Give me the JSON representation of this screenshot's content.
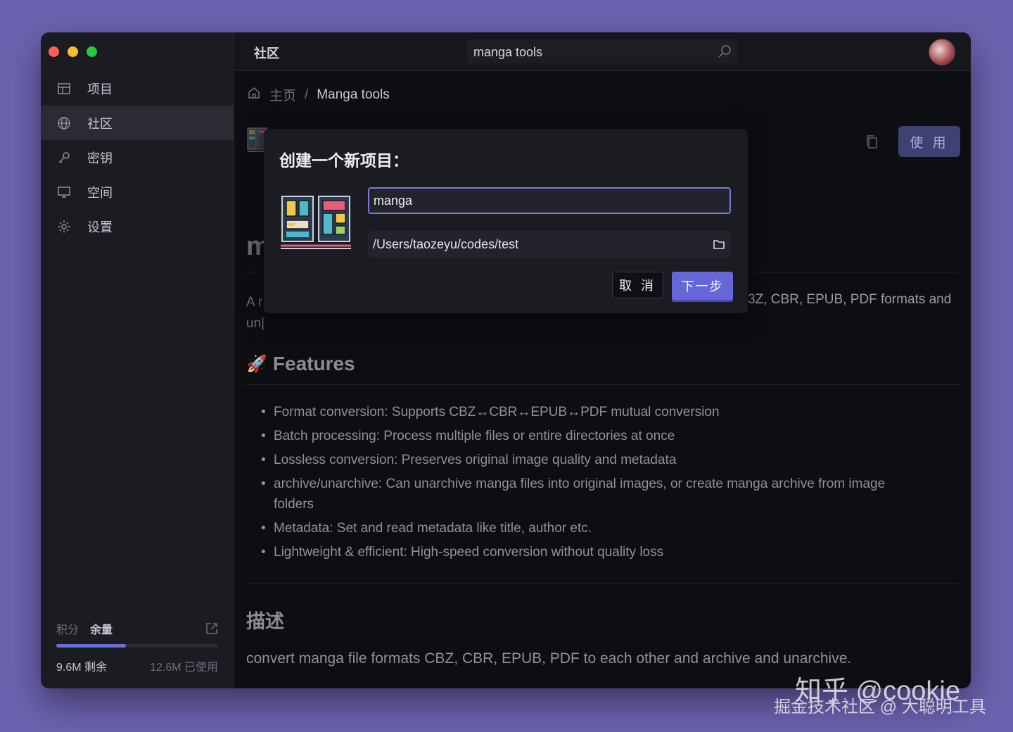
{
  "sidebar": {
    "items": [
      {
        "label": "项目",
        "icon": "grid-icon"
      },
      {
        "label": "社区",
        "icon": "globe-icon"
      },
      {
        "label": "密钥",
        "icon": "key-icon"
      },
      {
        "label": "空间",
        "icon": "monitor-icon"
      },
      {
        "label": "设置",
        "icon": "gear-icon"
      }
    ],
    "active": "社区",
    "footer": {
      "tab_points": "积分",
      "tab_balance": "余量",
      "remaining": "9.6M 剩余",
      "used": "12.6M 已使用",
      "usage_fraction": 0.43
    }
  },
  "topbar": {
    "title": "社区",
    "search_value": "manga tools"
  },
  "breadcrumb": {
    "home": "主页",
    "separator": "/",
    "current": "Manga tools"
  },
  "page": {
    "use_button": "使 用",
    "heading_partial": "m",
    "desc_left_line1": "A r",
    "desc_left_line2": "un|",
    "desc_right": "3Z, CBR, EPUB, PDF formats and",
    "features_icon": "rocket-icon",
    "features_title": "Features",
    "features": [
      "Format conversion: Supports CBZ↔CBR↔EPUB↔PDF mutual conversion",
      "Batch processing: Process multiple files or entire directories at once",
      "Lossless conversion: Preserves original image quality and metadata",
      "archive/unarchive: Can unarchive manga files into original images, or create manga archive from image folders",
      "Metadata: Set and read metadata like title, author etc.",
      "Lightweight & efficient: High-speed conversion without quality loss"
    ],
    "section_desc_title": "描述",
    "section_desc_text": "convert manga file formats CBZ, CBR, EPUB, PDF to each other and archive and unarchive."
  },
  "dialog": {
    "title": "创建一个新项目：",
    "name_value": "manga",
    "path_value": "/Users/taozeyu/codes/test",
    "cancel": "取 消",
    "next": "下一步"
  },
  "watermark": {
    "line1": "知乎 @cookie",
    "line2": "掘金技术社区 @ 大聪明工具"
  },
  "colors": {
    "accent": "#6566d8",
    "background": "#6c63b0",
    "sidebar": "#1b1c22",
    "content": "#0d0e12"
  }
}
